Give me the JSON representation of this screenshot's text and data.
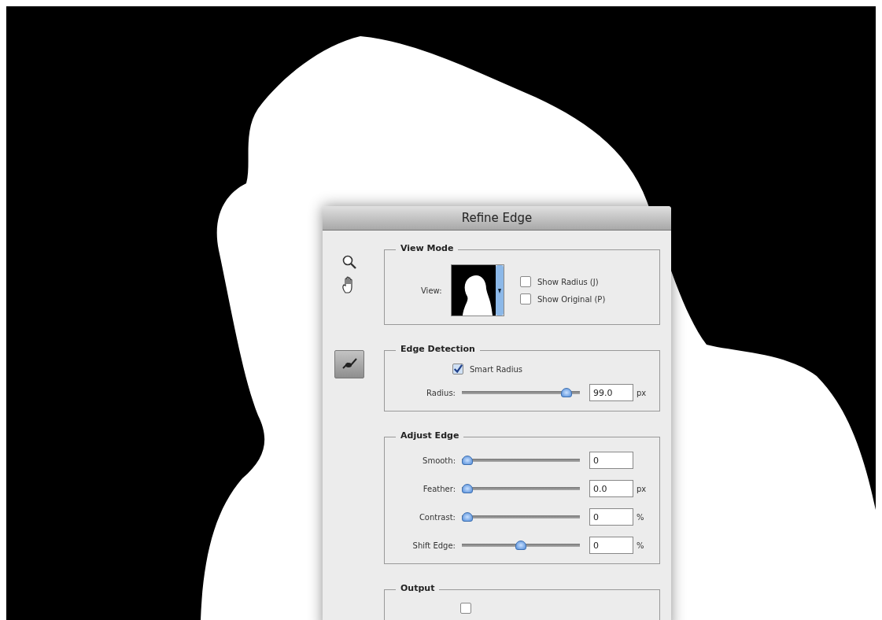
{
  "dialog": {
    "title": "Refine Edge"
  },
  "view_mode": {
    "title": "View Mode",
    "view_label": "View:",
    "options": [
      {
        "label": "Show Radius (J)",
        "checked": false
      },
      {
        "label": "Show Original (P)",
        "checked": false
      }
    ]
  },
  "edge_detection": {
    "title": "Edge Detection",
    "smart_radius": {
      "label": "Smart Radius",
      "checked": true
    },
    "sliders": [
      {
        "label": "Radius:",
        "level": 0.93,
        "value": "99.0",
        "unit": "px"
      }
    ]
  },
  "adjust_edge": {
    "title": "Adjust Edge",
    "sliders": [
      {
        "label": "Smooth:",
        "level": 0,
        "value": "0"
      },
      {
        "label": "Feather:",
        "level": 0,
        "value": "0.0",
        "unit": "px"
      },
      {
        "label": "Contrast:",
        "level": 0,
        "value": "0",
        "unit": "%"
      },
      {
        "label": "Shift Edge:",
        "level": 0.5,
        "value": "0",
        "unit": "%"
      }
    ]
  },
  "output": {
    "title": "Output",
    "options": [
      {
        "checked": false
      }
    ]
  }
}
